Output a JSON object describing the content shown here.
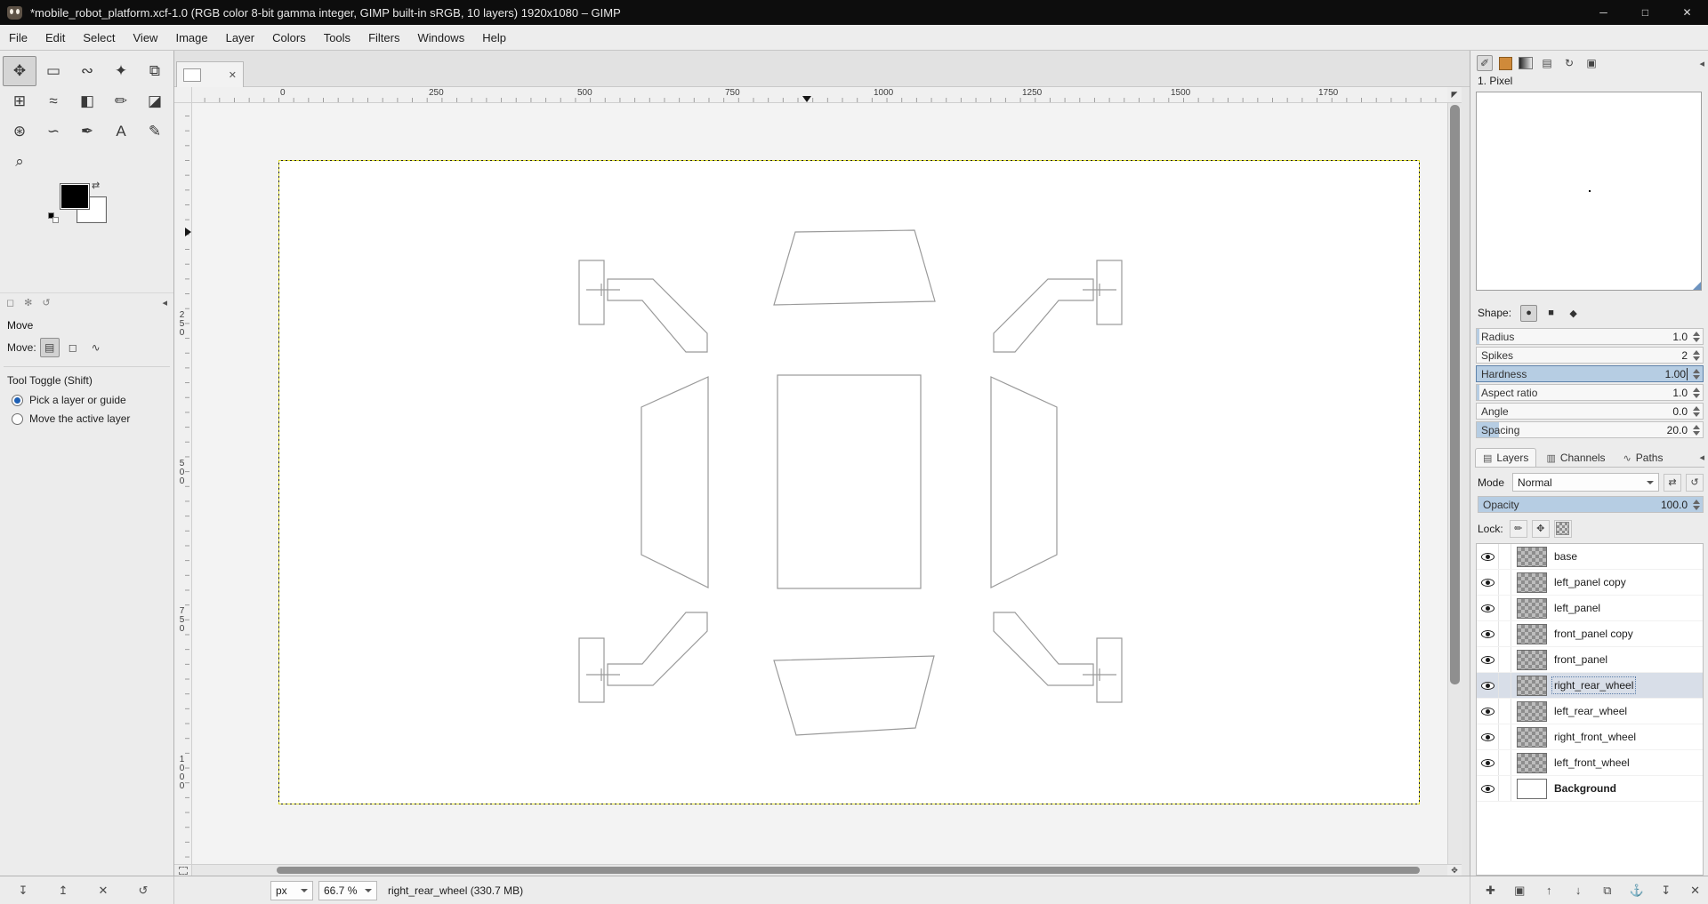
{
  "window": {
    "title": "*mobile_robot_platform.xcf-1.0 (RGB color 8-bit gamma integer, GIMP built-in sRGB, 10 layers) 1920x1080 – GIMP",
    "minimize": "─",
    "maximize": "□",
    "close": "✕"
  },
  "menubar": {
    "items": [
      "File",
      "Edit",
      "Select",
      "View",
      "Image",
      "Layer",
      "Colors",
      "Tools",
      "Filters",
      "Windows",
      "Help"
    ]
  },
  "toolbox": {
    "tools": [
      {
        "name": "Move",
        "glyph": "✥"
      },
      {
        "name": "Rectangle Select",
        "glyph": "▭"
      },
      {
        "name": "Free Select",
        "glyph": "∾"
      },
      {
        "name": "Fuzzy Select",
        "glyph": "✦"
      },
      {
        "name": "Crop",
        "glyph": "⧉"
      },
      {
        "name": "Unified Transform",
        "glyph": "⊞"
      },
      {
        "name": "Warp Transform",
        "glyph": "≈"
      },
      {
        "name": "Bucket Fill",
        "glyph": "◧"
      },
      {
        "name": "Pencil",
        "glyph": "✏"
      },
      {
        "name": "Eraser",
        "glyph": "◪"
      },
      {
        "name": "Clone",
        "glyph": "⊛"
      },
      {
        "name": "Smudge",
        "glyph": "∽"
      },
      {
        "name": "Ink",
        "glyph": "✒"
      },
      {
        "name": "Text",
        "glyph": "A"
      },
      {
        "name": "Color Picker",
        "glyph": "✎"
      },
      {
        "name": "Zoom",
        "glyph": "⌕"
      }
    ]
  },
  "tool_options": {
    "header_icons": [
      "◻",
      "✻",
      "↺"
    ],
    "collapse_icon": "◂",
    "title": "Move",
    "move_label": "Move:",
    "move_buttons": [
      "▤",
      "◻",
      "∿"
    ],
    "toggle_label": "Tool Toggle  (Shift)",
    "radios": [
      {
        "label": "Pick a layer or guide"
      },
      {
        "label": "Move the active layer"
      }
    ],
    "preset_buttons": [
      "↧",
      "↥",
      "✕",
      "↺"
    ]
  },
  "canvas": {
    "tab_close": "✕",
    "menu_button": "◤",
    "nav_button": "✥",
    "h_ruler": [
      "0",
      "250",
      "500",
      "750",
      "1000",
      "1250",
      "1500",
      "1750"
    ],
    "v_ruler": [
      "250",
      "500",
      "750",
      "1000"
    ]
  },
  "brush_dock": {
    "tab_icons": [
      "✐",
      "▤",
      "↻",
      "▣"
    ],
    "collapse_icon": "◂",
    "brush_name": "1. Pixel",
    "shape_label": "Shape:",
    "shape_circle": "●",
    "shape_square": "■",
    "shape_diamond": "◆",
    "params": [
      {
        "label": "Radius",
        "value": "1.0",
        "fill": 1
      },
      {
        "label": "Spikes",
        "value": "2",
        "fill": 0
      },
      {
        "label": "Hardness",
        "value": "1.00",
        "fill": 100
      },
      {
        "label": "Aspect ratio",
        "value": "1.0",
        "fill": 1
      },
      {
        "label": "Angle",
        "value": "0.0",
        "fill": 0
      },
      {
        "label": "Spacing",
        "value": "20.0",
        "fill": 10
      }
    ]
  },
  "layers_dock": {
    "tabs": [
      {
        "icon": "▤",
        "label": "Layers"
      },
      {
        "icon": "▥",
        "label": "Channels"
      },
      {
        "icon": "∿",
        "label": "Paths"
      }
    ],
    "collapse_icon": "◂",
    "mode_label": "Mode",
    "mode_value": "Normal",
    "mode_buttons": [
      "⇄",
      "↺"
    ],
    "opacity_label": "Opacity",
    "opacity_value": "100.0",
    "opacity_fill": 100,
    "lock_label": "Lock:",
    "lock_buttons": [
      "✏",
      "✥"
    ],
    "layers": [
      {
        "name": "base"
      },
      {
        "name": "left_panel copy"
      },
      {
        "name": "left_panel"
      },
      {
        "name": "front_panel copy"
      },
      {
        "name": "front_panel"
      },
      {
        "name": "right_rear_wheel"
      },
      {
        "name": "left_rear_wheel"
      },
      {
        "name": "right_front_wheel"
      },
      {
        "name": "left_front_wheel"
      },
      {
        "name": "Background"
      }
    ],
    "action_buttons": [
      "✚",
      "▣",
      "↑",
      "↓",
      "⧉",
      "⚓",
      "↧",
      "✕"
    ]
  },
  "statusbar": {
    "unit": "px",
    "zoom": "66.7 %",
    "message": "right_rear_wheel (330.7 MB)"
  },
  "colors": {
    "accent": "#1d5fb4",
    "slider_fill": "#b6cde3",
    "foreground": "#000000",
    "background_color": "#ffffff"
  }
}
